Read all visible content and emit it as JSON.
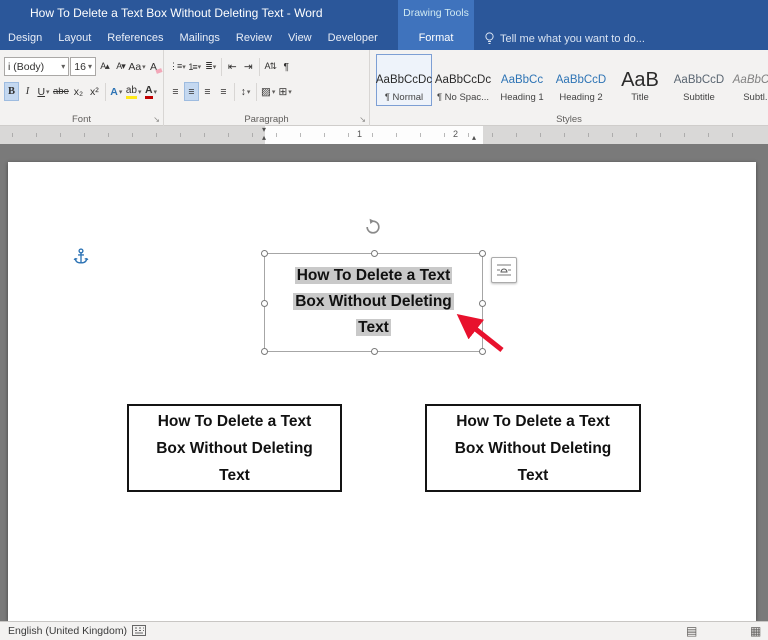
{
  "window": {
    "title": "How To Delete a Text Box Without Deleting Text - Word",
    "contextual_label": "Drawing Tools"
  },
  "tabs": {
    "items": [
      {
        "label": "Design"
      },
      {
        "label": "Layout"
      },
      {
        "label": "References"
      },
      {
        "label": "Mailings"
      },
      {
        "label": "Review"
      },
      {
        "label": "View"
      },
      {
        "label": "Developer"
      }
    ],
    "contextual_tab": "Format",
    "tell_me": "Tell me what you want to do..."
  },
  "ribbon": {
    "font": {
      "label": "Font",
      "font_name": "i (Body)",
      "font_size": "16"
    },
    "paragraph": {
      "label": "Paragraph"
    },
    "styles": {
      "label": "Styles",
      "items": [
        {
          "sample": "AaBbCcDc",
          "name": "¶ Normal"
        },
        {
          "sample": "AaBbCcDc",
          "name": "¶ No Spac..."
        },
        {
          "sample": "AaBbCc",
          "name": "Heading 1"
        },
        {
          "sample": "AaBbCcD",
          "name": "Heading 2"
        },
        {
          "sample": "AaB",
          "name": "Title"
        },
        {
          "sample": "AaBbCcD",
          "name": "Subtitle"
        },
        {
          "sample": "AaBbCcD",
          "name": "Subtl..."
        }
      ]
    }
  },
  "icons": {
    "dropdown": "▾",
    "dialog_launcher": "↘",
    "grow_font": "A▴",
    "shrink_font": "A▾",
    "change_case": "Aa",
    "clear_formatting": "A",
    "bold": "B",
    "italic": "I",
    "underline": "U",
    "strikethrough": "abe",
    "subscript": "x₂",
    "superscript": "x²",
    "text_effects": "A",
    "highlight": "ab",
    "font_color": "A",
    "bullets": "⋮≡",
    "numbering": "1≡",
    "multilevel": "≣",
    "outdent": "⇤",
    "indent": "⇥",
    "sort": "A⇅",
    "pilcrow": "¶",
    "align_left": "≡",
    "align_center": "≡",
    "align_right": "≡",
    "align_justify": "≡",
    "line_spacing": "↕",
    "shading": "▨",
    "borders": "⊞"
  },
  "ruler": {
    "numbers": [
      "1",
      "2"
    ]
  },
  "document": {
    "textbox_lines": {
      "line1": "How To Delete a Text",
      "line2": "Box Without Deleting",
      "line3": "Text"
    }
  },
  "statusbar": {
    "language": "English (United Kingdom)"
  },
  "colors": {
    "titlebar": "#2b579a",
    "contextual_band": "#3f73bd",
    "heading_style": "#2e74b5",
    "highlight_yellow": "#ffe81a",
    "font_color_red": "#c00000",
    "arrow_red": "#e8112d",
    "selection_gray": "#c9c9c9"
  }
}
